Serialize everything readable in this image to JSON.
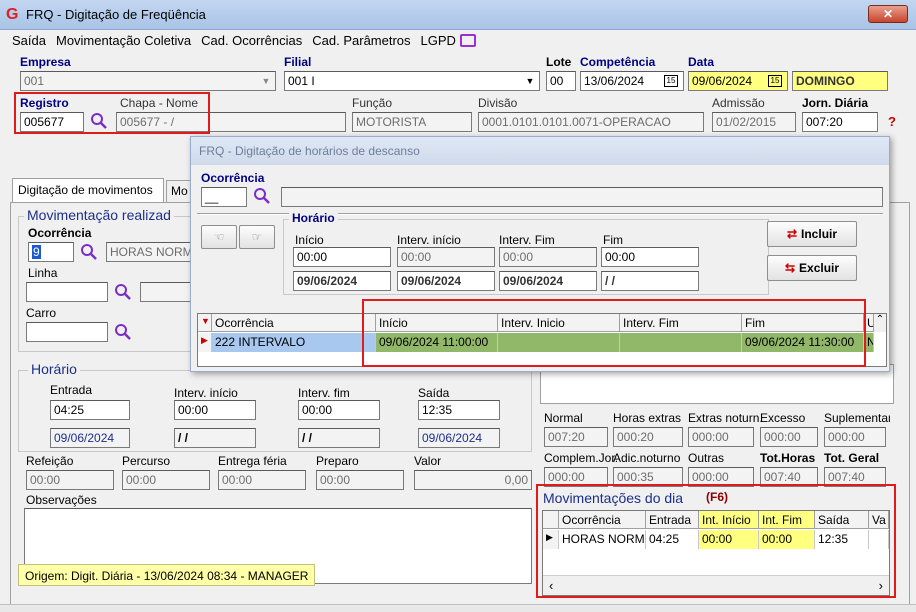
{
  "window": {
    "title": "FRQ - Digitação de Freqüência",
    "logo": "G"
  },
  "menu": [
    "Saída",
    "Movimentação Coletiva",
    "Cad. Ocorrências",
    "Cad. Parâmetros",
    "LGPD"
  ],
  "header": {
    "empresa_label": "Empresa",
    "empresa_value": "001",
    "filial_label": "Filial",
    "filial_value": "001 I",
    "lote_label": "Lote",
    "lote_value": "00",
    "competencia_label": "Competência",
    "competencia_value": "13/06/2024",
    "data_label": "Data",
    "data_value": "09/06/2024",
    "day_value": "DOMINGO",
    "registro_label": "Registro",
    "registro_value": "005677",
    "chapa_label": "Chapa  -  Nome",
    "chapa_value": "005677 - /",
    "funcao_label": "Função",
    "funcao_value": "MOTORISTA",
    "divisao_label": "Divisão",
    "divisao_value": "0001.0101.0101.0071-OPERACAO",
    "admissao_label": "Admissão",
    "admissao_value": "01/02/2015",
    "jorn_label": "Jorn. Diária",
    "jorn_value": "007:20",
    "help": "?"
  },
  "tabs": [
    "Digitação de movimentos",
    "Mo"
  ],
  "mov": {
    "title": "Movimentação realizad",
    "ocorrencia_label": "Ocorrência",
    "ocorrencia_value": "9",
    "ocorrencia_desc": "HORAS NORM",
    "linha_label": "Linha",
    "carro_label": "Carro"
  },
  "horario": {
    "title": "Horário",
    "entrada_label": "Entrada",
    "entrada_value": "04:25",
    "entrada_date": "09/06/2024",
    "int_inicio_label": "Interv. início",
    "int_inicio_value": "00:00",
    "int_inicio_date": " / /",
    "int_fim_label": "Interv. fim",
    "int_fim_value": "00:00",
    "int_fim_date": " / /",
    "saida_label": "Saída",
    "saida_value": "12:35",
    "saida_date": "09/06/2024"
  },
  "extras": {
    "refeicao_label": "Refeição",
    "refeicao_value": "00:00",
    "percurso_label": "Percurso",
    "percurso_value": "00:00",
    "entrega_label": "Entrega féria",
    "entrega_value": "00:00",
    "preparo_label": "Preparo",
    "preparo_value": "00:00",
    "valor_label": "Valor",
    "valor_value": "0,00",
    "obs_label": "Observações"
  },
  "origem": "Origem: Digit. Diária - 13/06/2024 08:34 - MANAGER",
  "totals": {
    "labels1": [
      "Normal",
      "Horas extras",
      "Extras noturn.",
      "Excesso",
      "Suplementar"
    ],
    "values1": [
      "007:20",
      "000:20",
      "000:00",
      "000:00",
      "000:00"
    ],
    "labels2": [
      "Complem.Jor.",
      "Adic.noturno",
      "Outras",
      "Tot.Horas",
      "Tot. Geral"
    ],
    "values2": [
      "000:00",
      "000:35",
      "000:00",
      "007:40",
      "007:40"
    ]
  },
  "mov_dia": {
    "title": "Movimentações do dia",
    "shortcut": "(F6)",
    "headers": [
      "Ocorrência",
      "Entrada",
      "Int. Início",
      "Int. Fim",
      "Saída",
      "Va"
    ],
    "row": [
      "HORAS NORM",
      "04:25",
      "00:00",
      "00:00",
      "12:35",
      ""
    ]
  },
  "dialog": {
    "title": "FRQ - Digitação de horários de descanso",
    "ocorrencia_label": "Ocorrência",
    "ocorrencia_value": "__",
    "horario_title": "Horário",
    "inicio_label": "Início",
    "inicio_value": "00:00",
    "inicio_date": "09/06/2024",
    "int_inicio_label": "Interv. início",
    "int_inicio_value": "00:00",
    "int_inicio_date": "09/06/2024",
    "int_fim_label": "Interv. Fim",
    "int_fim_value": "00:00",
    "int_fim_date": "09/06/2024",
    "fim_label": "Fim",
    "fim_value": "00:00",
    "fim_date": " / /",
    "incluir_label": "Incluir",
    "excluir_label": "Excluir",
    "grid_headers": [
      "Ocorrência",
      "Início",
      "Interv. Inicio",
      "Interv. Fim",
      "Fim",
      "U"
    ],
    "grid_row": [
      "222 INTERVALO",
      "09/06/2024 11:00:00",
      "",
      "",
      "09/06/2024 11:30:00",
      "N"
    ]
  }
}
